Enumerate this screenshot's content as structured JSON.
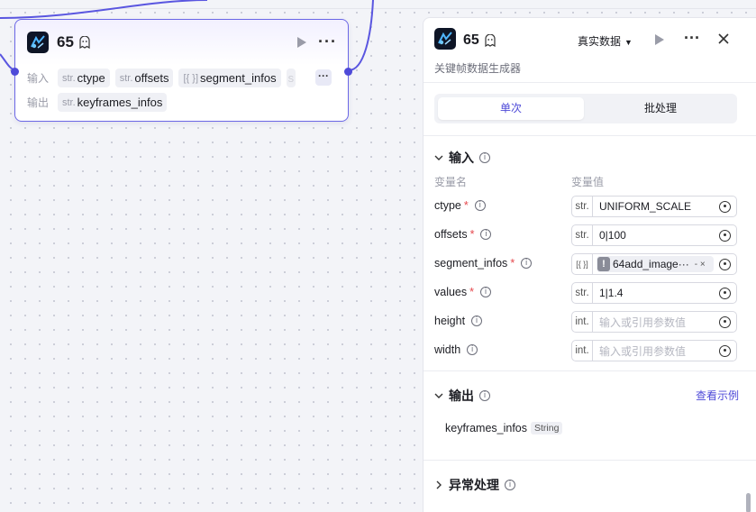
{
  "node": {
    "title": "65",
    "inputs_label": "输入",
    "outputs_label": "输出",
    "inputs": [
      {
        "type": "str.",
        "name": "ctype"
      },
      {
        "type": "str.",
        "name": "offsets"
      },
      {
        "type": "[{ }]",
        "name": "segment_infos"
      }
    ],
    "outputs": [
      {
        "type": "str.",
        "name": "keyframes_infos"
      }
    ],
    "more_inputs_label": "···"
  },
  "panel": {
    "title": "65",
    "data_mode": "真实数据",
    "description": "关键帧数据生成器",
    "tabs": {
      "single": "单次",
      "batch": "批处理"
    },
    "input_section": {
      "title": "输入",
      "col_name": "变量名",
      "col_value": "变量值",
      "rows": [
        {
          "name": "ctype",
          "required": "*",
          "type": "str.",
          "value": "UNIFORM_SCALE",
          "placeholder": ""
        },
        {
          "name": "offsets",
          "required": "*",
          "type": "str.",
          "value": "0|100",
          "placeholder": ""
        },
        {
          "name": "segment_infos",
          "required": "*",
          "type": "[{ }]",
          "ref": "64add_image···",
          "ref_suffix": "- ×"
        },
        {
          "name": "values",
          "required": "*",
          "type": "str.",
          "value": "1|1.4",
          "placeholder": ""
        },
        {
          "name": "height",
          "required": "",
          "type": "int.",
          "value": "",
          "placeholder": "输入或引用参数值"
        },
        {
          "name": "width",
          "required": "",
          "type": "int.",
          "value": "",
          "placeholder": "输入或引用参数值"
        }
      ]
    },
    "output_section": {
      "title": "输出",
      "example_link": "查看示例",
      "var_name": "keyframes_infos",
      "var_type": "String"
    },
    "error_section": {
      "title": "异常处理"
    }
  },
  "colors": {
    "accent": "#4e4ad8",
    "node_border": "#6b67e6",
    "required": "#e5484d"
  },
  "icons": [
    "app-logo-icon",
    "ghost-icon",
    "play-icon",
    "more-icon",
    "close-icon",
    "chevron-down-icon",
    "chevron-right-icon",
    "info-icon",
    "reference-icon",
    "warning-icon"
  ]
}
